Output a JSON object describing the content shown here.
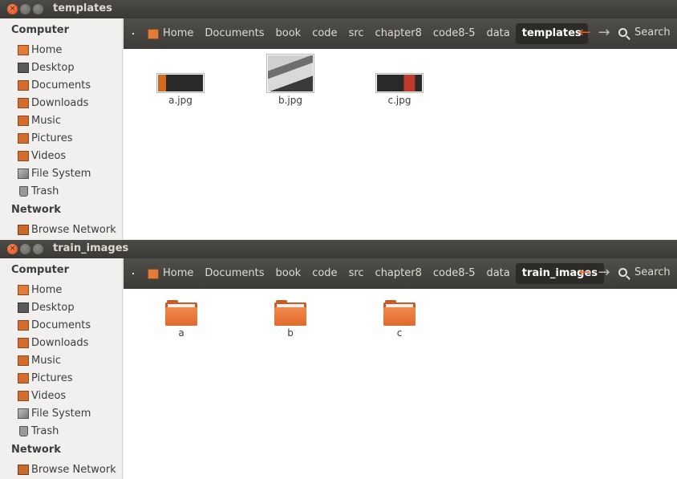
{
  "windows": [
    {
      "title": "templates",
      "sidebar": {
        "computer_heading": "Computer",
        "items": [
          {
            "label": "Home",
            "icon": "home-folder-icon"
          },
          {
            "label": "Desktop",
            "icon": "desktop-icon"
          },
          {
            "label": "Documents",
            "icon": "documents-folder-icon"
          },
          {
            "label": "Downloads",
            "icon": "downloads-folder-icon"
          },
          {
            "label": "Music",
            "icon": "music-folder-icon"
          },
          {
            "label": "Pictures",
            "icon": "pictures-folder-icon"
          },
          {
            "label": "Videos",
            "icon": "videos-folder-icon"
          },
          {
            "label": "File System",
            "icon": "filesystem-icon"
          },
          {
            "label": "Trash",
            "icon": "trash-icon"
          }
        ],
        "network_heading": "Network",
        "network_items": [
          {
            "label": "Browse Network",
            "icon": "network-icon"
          }
        ]
      },
      "breadcrumbs": [
        "Home",
        "Documents",
        "book",
        "code",
        "src",
        "chapter8",
        "code8-5",
        "data",
        "templates"
      ],
      "search_label": "Search",
      "files": [
        {
          "name": "a.jpg",
          "kind": "image"
        },
        {
          "name": "b.jpg",
          "kind": "image"
        },
        {
          "name": "c.jpg",
          "kind": "image"
        }
      ]
    },
    {
      "title": "train_images",
      "sidebar": {
        "computer_heading": "Computer",
        "items": [
          {
            "label": "Home",
            "icon": "home-folder-icon"
          },
          {
            "label": "Desktop",
            "icon": "desktop-icon"
          },
          {
            "label": "Documents",
            "icon": "documents-folder-icon"
          },
          {
            "label": "Downloads",
            "icon": "downloads-folder-icon"
          },
          {
            "label": "Music",
            "icon": "music-folder-icon"
          },
          {
            "label": "Pictures",
            "icon": "pictures-folder-icon"
          },
          {
            "label": "Videos",
            "icon": "videos-folder-icon"
          },
          {
            "label": "File System",
            "icon": "filesystem-icon"
          },
          {
            "label": "Trash",
            "icon": "trash-icon"
          }
        ],
        "network_heading": "Network",
        "network_items": [
          {
            "label": "Browse Network",
            "icon": "network-icon"
          }
        ]
      },
      "breadcrumbs": [
        "Home",
        "Documents",
        "book",
        "code",
        "src",
        "chapter8",
        "code8-5",
        "data",
        "train_images"
      ],
      "search_label": "Search",
      "files": [
        {
          "name": "a",
          "kind": "folder"
        },
        {
          "name": "b",
          "kind": "folder"
        },
        {
          "name": "c",
          "kind": "folder"
        }
      ]
    }
  ],
  "colors": {
    "accent_orange": "#e8612c",
    "titlebar": "#3c3b37",
    "sidebar_bg": "#f1f0ef",
    "content_bg": "#ffffff",
    "folder_orange": "#e06a2c"
  }
}
